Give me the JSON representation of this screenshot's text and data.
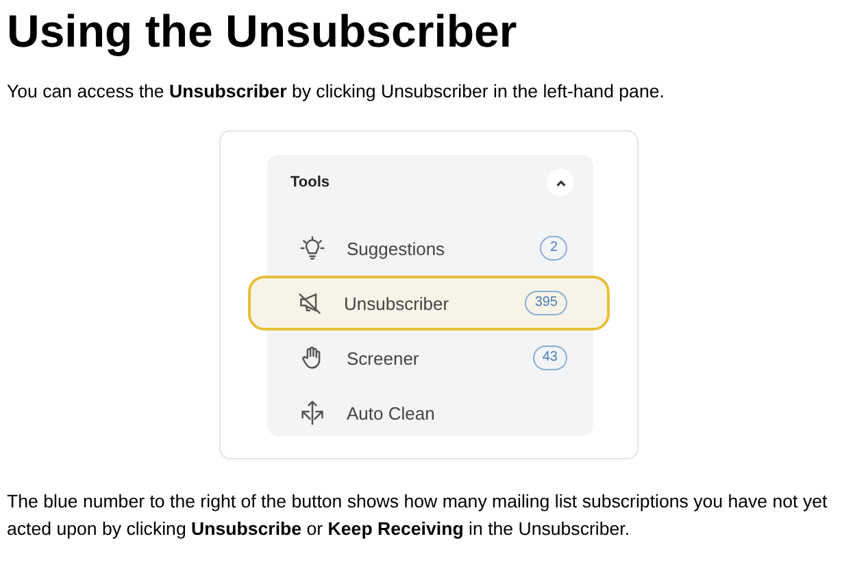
{
  "title": "Using the Unsubscriber",
  "intro": "You can access the **Unsubscriber** by clicking Unsubscriber in the left-hand pane.",
  "panel": {
    "heading": "Tools",
    "expanded": true,
    "items": [
      {
        "label": "Suggestions",
        "count": "2",
        "highlighted": false
      },
      {
        "label": "Unsubscriber",
        "count": "395",
        "highlighted": true
      },
      {
        "label": "Screener",
        "count": "43",
        "highlighted": false
      },
      {
        "label": "Auto Clean",
        "highlighted": false
      }
    ]
  },
  "note": "The blue number to the right of the button shows how many mailing list subscriptions you have not yet acted upon by clicking **Unsubscribe** or **Keep Receiving** in the Unsubscriber."
}
